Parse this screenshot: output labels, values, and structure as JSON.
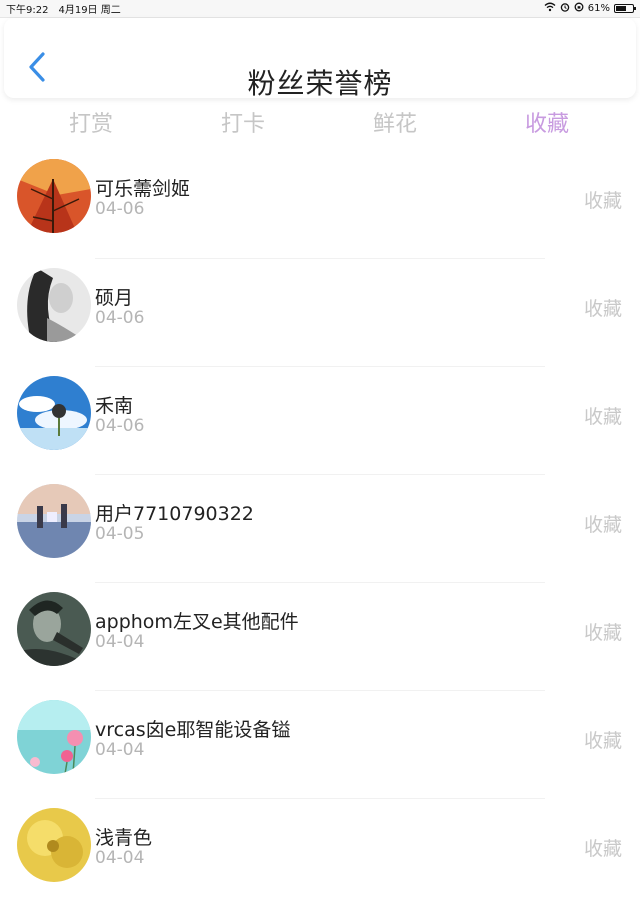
{
  "status_bar": {
    "time": "下午9:22",
    "date": "4月19日 周二",
    "battery_percent": "61%",
    "battery_level": 0.61,
    "icons": [
      "wifi-icon",
      "alarm-icon",
      "rotation-lock-icon",
      "battery-icon"
    ]
  },
  "header": {
    "title": "粉丝荣誉榜",
    "back_icon": "chevron-left-icon",
    "accent_color": "#3a8ee6"
  },
  "tabs": [
    {
      "label": "打赏",
      "active": false
    },
    {
      "label": "打卡",
      "active": false
    },
    {
      "label": "鲜花",
      "active": false
    },
    {
      "label": "收藏",
      "active": true
    }
  ],
  "active_tab_color": "#c89be0",
  "fans": [
    {
      "name": "可乐薷剑姬",
      "date": "04-06",
      "action": "收藏",
      "avatar": "autumn-leaves-avatar"
    },
    {
      "name": "硕月",
      "date": "04-06",
      "action": "收藏",
      "avatar": "bw-portrait-avatar"
    },
    {
      "name": "禾南",
      "date": "04-06",
      "action": "收藏",
      "avatar": "sky-dandelion-avatar"
    },
    {
      "name": "用户7710790322",
      "date": "04-05",
      "action": "收藏",
      "avatar": "reflection-landscape-avatar"
    },
    {
      "name": "apphom左叉e其他配件",
      "date": "04-04",
      "action": "收藏",
      "avatar": "singer-portrait-avatar"
    },
    {
      "name": "vrcas囟e耶智能设备镒",
      "date": "04-04",
      "action": "收藏",
      "avatar": "pink-flowers-avatar"
    },
    {
      "name": "浅青色",
      "date": "04-04",
      "action": "收藏",
      "avatar": "yellow-flower-avatar"
    }
  ]
}
